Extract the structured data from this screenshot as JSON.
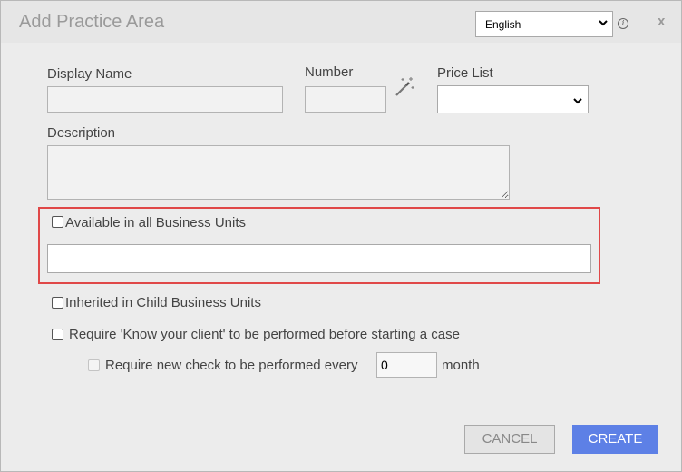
{
  "dialog": {
    "title": "Add Practice Area",
    "language": {
      "selected": "English"
    },
    "close_label": "x",
    "info_label": "i"
  },
  "form": {
    "display_name_label": "Display Name",
    "number_label": "Number",
    "price_list_label": "Price List",
    "description_label": "Description",
    "available_all_bu_label": "Available in all Business Units",
    "inherited_child_bu_label": "Inherited in Child Business Units",
    "kyc_label": "Require 'Know your client' to be performed before starting a case",
    "recheck_label": "Require new check to be performed every",
    "recheck_value": "0",
    "recheck_unit": "month"
  },
  "buttons": {
    "cancel": "CANCEL",
    "create": "CREATE"
  },
  "colors": {
    "primary": "#5d80e6",
    "highlight_border": "#e04848"
  },
  "icons": {
    "magic_wand": "magic-wand-icon",
    "dropdown": "chevron-down-icon",
    "info": "info-icon",
    "close": "close-icon"
  }
}
